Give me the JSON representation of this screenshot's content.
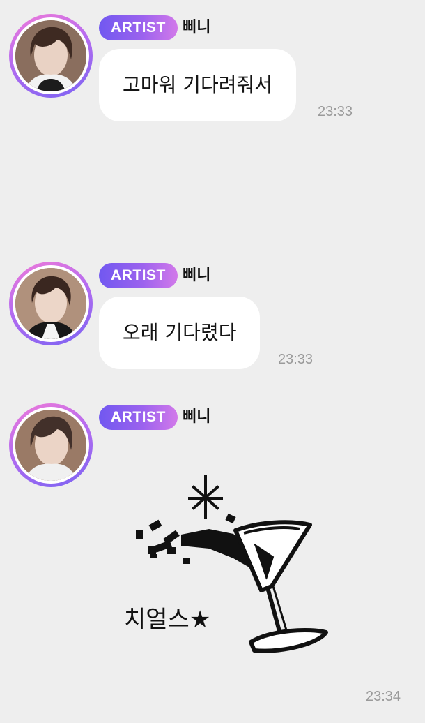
{
  "messages": [
    {
      "badge": "ARTIST",
      "sender": "삐니",
      "text": "고마워 기다려줘서",
      "time": "23:33"
    },
    {
      "badge": "ARTIST",
      "sender": "삐니",
      "text": "오래 기다렸다",
      "time": "23:33"
    },
    {
      "badge": "ARTIST",
      "sender": "삐니",
      "sticker_text": "치얼스★",
      "sticker_icon": "cocktail-cheers-icon",
      "time": "23:34"
    }
  ],
  "colors": {
    "background": "#eeeeee",
    "bubble": "#ffffff",
    "badge_start": "#7158f0",
    "badge_end": "#d279ea",
    "time_text": "#9a9a9a"
  }
}
